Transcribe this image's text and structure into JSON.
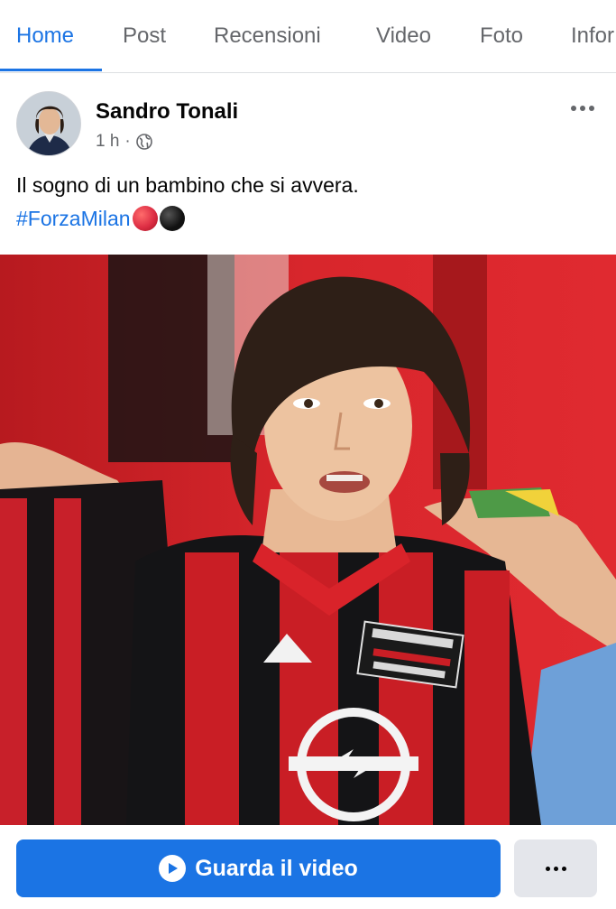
{
  "tabs": [
    {
      "label": "Home",
      "active": true
    },
    {
      "label": "Post"
    },
    {
      "label": "Recensioni"
    },
    {
      "label": "Video"
    },
    {
      "label": "Foto"
    },
    {
      "label": "Infor"
    }
  ],
  "post": {
    "author": "Sandro Tonali",
    "time": "1 h",
    "separator": "·",
    "privacy_icon": "globe-icon",
    "text": "Il sogno di un bambino che si avvera.",
    "hashtag": "#ForzaMilan",
    "emojis": [
      {
        "name": "red-circle-emoji",
        "color": "#dd2e44"
      },
      {
        "name": "black-circle-emoji",
        "color": "#111111"
      }
    ],
    "image": "Young boy with long dark hair wearing a red and black striped AC Milan jersey",
    "sponsor_logo": "Opel"
  },
  "actions": {
    "watch_label": "Guarda il video",
    "more_label": "..."
  },
  "colors": {
    "accent": "#1b74e4",
    "muted": "#65676b",
    "divider": "#dddfe2",
    "jersey_red": "#c41c21",
    "jersey_black": "#141416"
  }
}
